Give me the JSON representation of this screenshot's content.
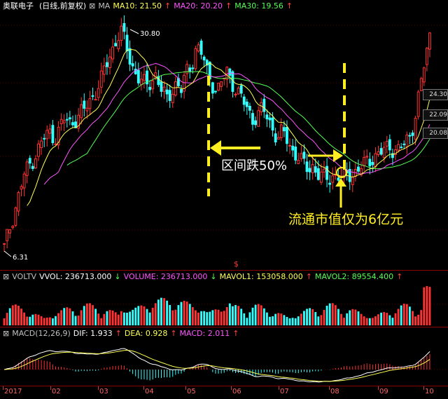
{
  "header_main": {
    "stock_name": "奥联电子",
    "period": "(日线,前复权)",
    "indicator": "MA",
    "ma10": "MA10: 21.50",
    "ma20": "MA20: 20.20",
    "ma30": "MA30: 19.56"
  },
  "header_vol": {
    "name": "VOLTV",
    "vvol": "VVOL: 236713.000",
    "volume": "VOLUME: 236713.000",
    "mavol1": "MAVOL1: 153058.000",
    "mavol2": "MAVOL2: 89554.400"
  },
  "header_macd": {
    "name": "MACD(12,26,9)",
    "dif": "DIF: 1.933",
    "dea": "DEA: 0.928",
    "macd": "MACD: 2.011"
  },
  "price_labels": {
    "high": "30.80",
    "low": "6.31",
    "right_1": "24.30",
    "right_2": "22.09",
    "right_3": "20.08"
  },
  "annotations": {
    "drop_text": "区间跌50%",
    "cap_text": "流通市值仅为6亿元",
    "dollar_marker": "$"
  },
  "x_axis": {
    "labels": [
      "2017",
      "02",
      "03",
      "04",
      "05",
      "06",
      "07",
      "08",
      "09",
      "10"
    ]
  },
  "chart_data": {
    "type": "candlestick",
    "price_high": 30.8,
    "price_low": 6.31,
    "x_labels": [
      "2017",
      "02",
      "03",
      "04",
      "05",
      "06",
      "07",
      "08",
      "09",
      "10"
    ],
    "close_path": [
      7,
      9,
      11,
      13,
      15,
      16,
      17,
      18,
      19,
      19.5,
      19,
      20,
      21,
      20.5,
      21,
      21.5,
      22,
      23,
      24,
      25,
      26.5,
      28,
      29.5,
      30.5,
      29,
      27,
      26,
      25,
      24.5,
      25,
      26,
      24,
      23,
      24,
      25,
      24,
      26,
      27,
      29,
      28,
      26,
      25,
      24,
      25,
      26,
      25,
      24,
      23,
      22,
      21,
      21.5,
      22,
      21,
      20,
      19,
      19.5,
      18.5,
      17.5,
      17,
      16,
      15.5,
      16,
      15,
      14.5,
      14.5,
      15,
      14.8,
      14.5,
      15,
      15.2,
      15.5,
      16,
      16.5,
      17,
      17.2,
      17.5,
      18,
      17.8,
      17.6,
      18.2,
      19,
      21,
      24,
      27,
      30
    ],
    "colors": {
      "up": "#ff3333",
      "down": "#33ffff",
      "ma10": "#ffff55",
      "ma20": "#ff55ff",
      "ma30": "#55ff55",
      "macd_pos": "#ff3333",
      "macd_neg": "#33ffff"
    }
  }
}
